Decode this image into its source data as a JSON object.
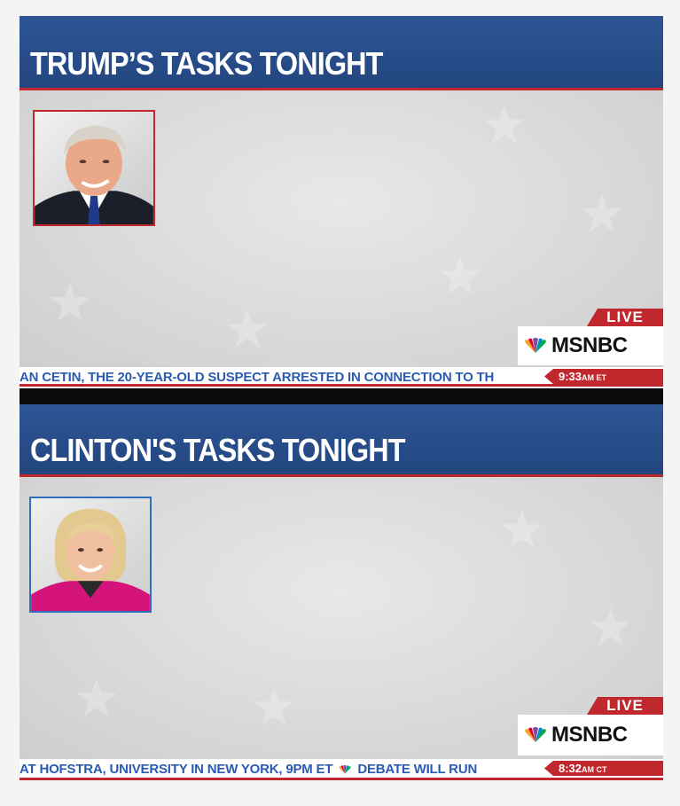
{
  "panels": [
    {
      "title": "TRUMP’S TASKS TONIGHT",
      "live_label": "LIVE",
      "network": "MSNBC",
      "ticker_text": "AN CETIN, THE 20-YEAR-OLD SUSPECT ARRESTED IN CONNECTION TO TH",
      "time": "9:33",
      "time_suffix": "AM ET",
      "frame_color": "#c0282e"
    },
    {
      "title": "CLINTON'S TASKS TONIGHT",
      "live_label": "LIVE",
      "network": "MSNBC",
      "ticker_text": "AT HOFSTRA, UNIVERSITY IN NEW YORK, 9PM ET",
      "ticker_text_2": "DEBATE WILL RUN",
      "time": "8:32",
      "time_suffix": "AM CT",
      "frame_color": "#2e6fc0"
    }
  ],
  "colors": {
    "header_blue": "#2a4f8f",
    "accent_red": "#c0282e",
    "ticker_blue": "#2b5bb0"
  },
  "icons": [
    "nbc-peacock-icon",
    "trump-portrait",
    "clinton-portrait"
  ]
}
